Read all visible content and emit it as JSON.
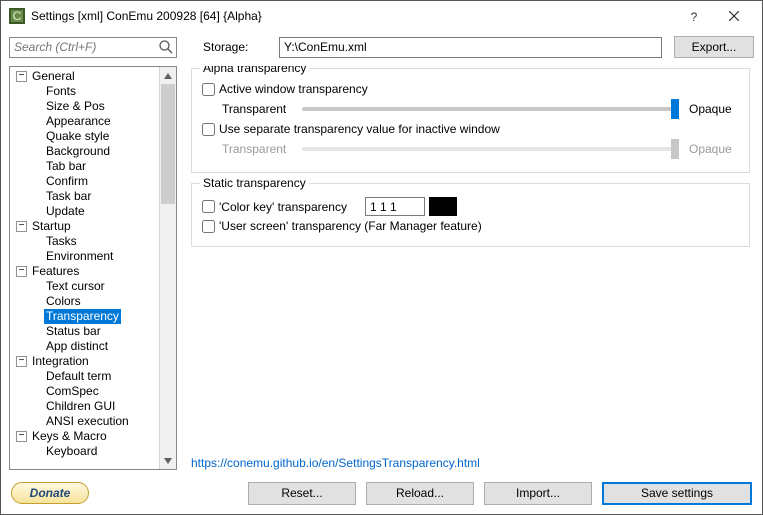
{
  "window": {
    "title": "Settings [xml] ConEmu 200928 [64] {Alpha}"
  },
  "search": {
    "placeholder": "Search (Ctrl+F)"
  },
  "storage": {
    "label": "Storage:",
    "value": "Y:\\ConEmu.xml",
    "export": "Export..."
  },
  "tree": {
    "groups": [
      {
        "label": "General",
        "children": [
          "Fonts",
          "Size & Pos",
          "Appearance",
          "Quake style",
          "Background",
          "Tab bar",
          "Confirm",
          "Task bar",
          "Update"
        ]
      },
      {
        "label": "Startup",
        "children": [
          "Tasks",
          "Environment"
        ]
      },
      {
        "label": "Features",
        "children": [
          "Text cursor",
          "Colors",
          "Transparency",
          "Status bar",
          "App distinct"
        ]
      },
      {
        "label": "Integration",
        "children": [
          "Default term",
          "ComSpec",
          "Children GUI",
          "ANSI execution"
        ]
      },
      {
        "label": "Keys & Macro",
        "children": [
          "Keyboard"
        ]
      }
    ],
    "selected": "Transparency"
  },
  "alpha": {
    "legend": "Alpha transparency",
    "active_cb": "Active window transparency",
    "transparent": "Transparent",
    "opaque": "Opaque",
    "separate_cb": "Use separate transparency value for inactive window"
  },
  "static": {
    "legend": "Static transparency",
    "colorkey_cb": "'Color key' transparency",
    "colorkey_val": "1 1 1",
    "userscreen_cb": "'User screen' transparency (Far Manager feature)"
  },
  "helplink": "https://conemu.github.io/en/SettingsTransparency.html",
  "footer": {
    "donate": "Donate",
    "reset": "Reset...",
    "reload": "Reload...",
    "import": "Import...",
    "save": "Save settings"
  }
}
